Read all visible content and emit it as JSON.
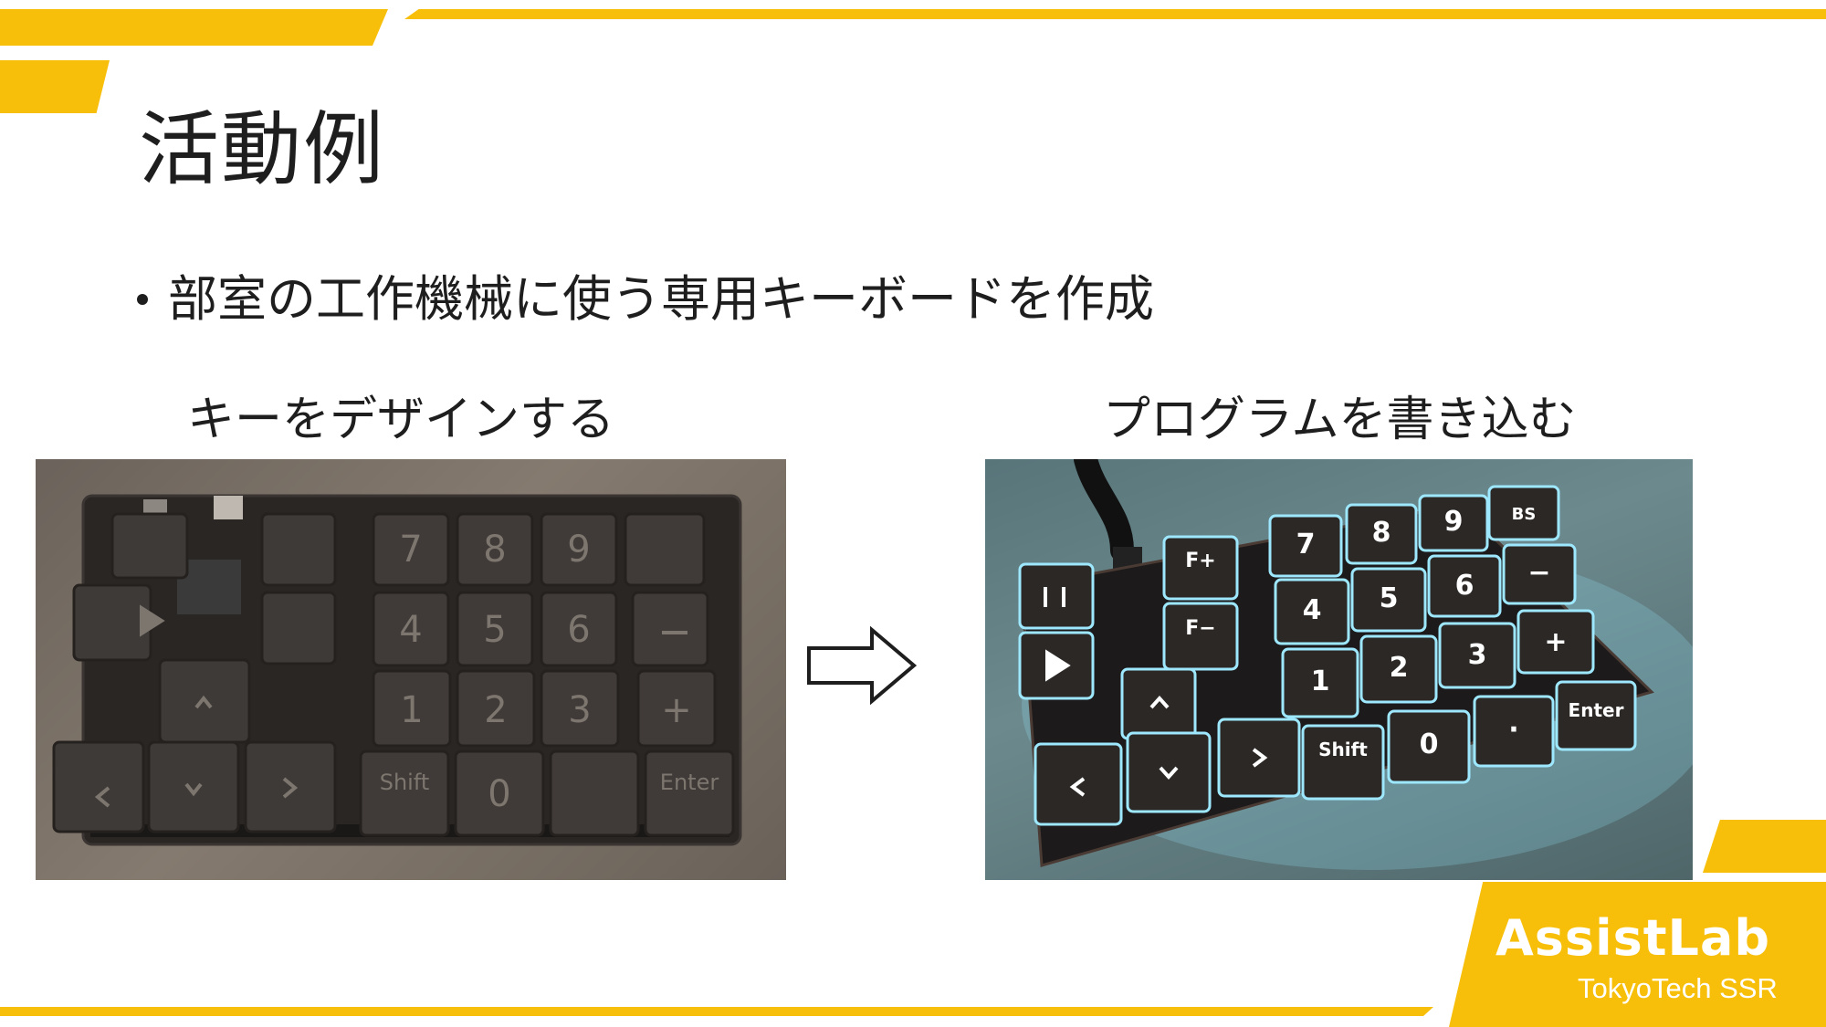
{
  "slide": {
    "title": "活動例",
    "bullet": "部室の工作機械に使う専用キーボードを作成",
    "captions": {
      "left": "キーをデザインする",
      "right": "プログラムを書き込む"
    }
  },
  "keyboard_left": {
    "keys": [
      "7",
      "8",
      "9",
      "4",
      "5",
      "6",
      "1",
      "2",
      "3",
      "+",
      "Shift",
      "0",
      "Enter"
    ]
  },
  "keyboard_right": {
    "keys": [
      "F+",
      "F−",
      "7",
      "8",
      "9",
      "BS",
      "4",
      "5",
      "6",
      "−",
      "1",
      "2",
      "3",
      "+",
      "Shift",
      "0",
      "·",
      "Enter"
    ]
  },
  "logo": {
    "name": "AssistLab",
    "subtitle": "TokyoTech SSR"
  },
  "colors": {
    "accent": "#f7bf0a",
    "text": "#1e1e1e",
    "key": "#2c2826",
    "board": "#1c1a1a",
    "led": "#9ee8ff"
  },
  "icons": [
    "arrow-right-icon"
  ]
}
